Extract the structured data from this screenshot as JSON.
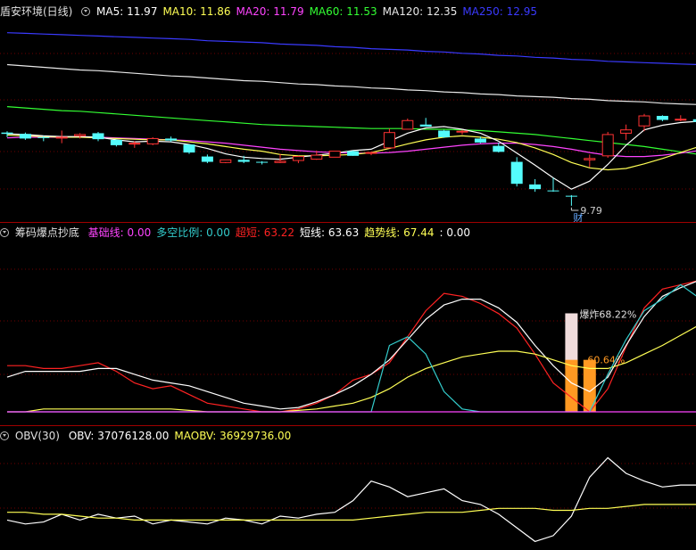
{
  "panels": {
    "price": {
      "title": "盾安环境(日线)",
      "indicators": [
        {
          "label": "MA5: ",
          "value": "11.97",
          "color": "#ffffff"
        },
        {
          "label": "MA10: ",
          "value": "11.86",
          "color": "#ffff55"
        },
        {
          "label": "MA20: ",
          "value": "11.79",
          "color": "#ff44ff"
        },
        {
          "label": "MA60: ",
          "value": "11.53",
          "color": "#33ff33"
        },
        {
          "label": "MA120: ",
          "value": "12.35",
          "color": "#e8e8e8"
        },
        {
          "label": "MA250: ",
          "value": "12.95",
          "color": "#3a3aff"
        }
      ],
      "low_label": "9.79",
      "note_label": "财"
    },
    "indicator": {
      "title": "筹码爆点抄底",
      "indicators": [
        {
          "label": "基础线: ",
          "value": "0.00",
          "color": "#ff44ff"
        },
        {
          "label": "多空比例: ",
          "value": "0.00",
          "color": "#33cccc"
        },
        {
          "label": "超短: ",
          "value": "63.22",
          "color": "#ff2222"
        },
        {
          "label": "短线: ",
          "value": "63.63",
          "color": "#ffffff"
        },
        {
          "label": "趋势线: ",
          "value": "67.44",
          "color": "#ffff55"
        },
        {
          "label": ": ",
          "value": "0.00",
          "color": "#ffffff"
        }
      ],
      "burst_label": "爆炸68.22%",
      "orange_label": "60.64%"
    },
    "obv": {
      "title": "OBV(30)",
      "indicators": [
        {
          "label": "OBV: ",
          "value": "37076128.00",
          "color": "#ffffff"
        },
        {
          "label": "MAOBV: ",
          "value": "36929736.00",
          "color": "#ffff55"
        }
      ]
    }
  },
  "colors": {
    "up": "#ff3333",
    "down": "#54fcfc",
    "divider": "#a00000",
    "ma5": "#ffffff",
    "ma10": "#ffff55",
    "ma20": "#ff44ff",
    "ma60": "#33ff33",
    "ma120": "#e8e8e8",
    "ma250": "#3a3aff",
    "burst": "#f0dcdc",
    "orange": "#ff9922"
  },
  "chart_data": [
    {
      "type": "candlestick",
      "candles": [
        {
          "o": 11.93,
          "h": 11.95,
          "l": 11.86,
          "c": 11.91
        },
        {
          "o": 11.91,
          "h": 11.93,
          "l": 11.82,
          "c": 11.84
        },
        {
          "o": 11.86,
          "h": 11.88,
          "l": 11.8,
          "c": 11.85
        },
        {
          "o": 11.86,
          "h": 11.96,
          "l": 11.77,
          "c": 11.86
        },
        {
          "o": 11.88,
          "h": 11.92,
          "l": 11.84,
          "c": 11.9
        },
        {
          "o": 11.92,
          "h": 11.94,
          "l": 11.8,
          "c": 11.83
        },
        {
          "o": 11.82,
          "h": 11.83,
          "l": 11.72,
          "c": 11.74
        },
        {
          "o": 11.77,
          "h": 11.8,
          "l": 11.7,
          "c": 11.77
        },
        {
          "o": 11.76,
          "h": 11.86,
          "l": 11.74,
          "c": 11.84
        },
        {
          "o": 11.84,
          "h": 11.87,
          "l": 11.79,
          "c": 11.81
        },
        {
          "o": 11.75,
          "h": 11.75,
          "l": 11.61,
          "c": 11.63
        },
        {
          "o": 11.57,
          "h": 11.6,
          "l": 11.47,
          "c": 11.49
        },
        {
          "o": 11.48,
          "h": 11.52,
          "l": 11.47,
          "c": 11.52
        },
        {
          "o": 11.52,
          "h": 11.58,
          "l": 11.47,
          "c": 11.49
        },
        {
          "o": 11.49,
          "h": 11.5,
          "l": 11.45,
          "c": 11.48
        },
        {
          "o": 11.48,
          "h": 11.61,
          "l": 11.47,
          "c": 11.5
        },
        {
          "o": 11.51,
          "h": 11.58,
          "l": 11.47,
          "c": 11.57
        },
        {
          "o": 11.53,
          "h": 11.66,
          "l": 11.52,
          "c": 11.59
        },
        {
          "o": 11.56,
          "h": 11.65,
          "l": 11.56,
          "c": 11.65
        },
        {
          "o": 11.65,
          "h": 11.66,
          "l": 11.58,
          "c": 11.58
        },
        {
          "o": 11.62,
          "h": 11.64,
          "l": 11.59,
          "c": 11.63
        },
        {
          "o": 11.7,
          "h": 11.99,
          "l": 11.7,
          "c": 11.93
        },
        {
          "o": 11.98,
          "h": 12.14,
          "l": 11.98,
          "c": 12.11
        },
        {
          "o": 12.05,
          "h": 12.15,
          "l": 12.02,
          "c": 12.02
        },
        {
          "o": 11.96,
          "h": 11.97,
          "l": 11.85,
          "c": 11.86
        },
        {
          "o": 11.95,
          "h": 11.97,
          "l": 11.9,
          "c": 11.95
        },
        {
          "o": 11.84,
          "h": 11.87,
          "l": 11.77,
          "c": 11.78
        },
        {
          "o": 11.73,
          "h": 11.78,
          "l": 11.63,
          "c": 11.64
        },
        {
          "o": 11.49,
          "h": 11.56,
          "l": 11.12,
          "c": 11.16
        },
        {
          "o": 11.15,
          "h": 11.23,
          "l": 11.04,
          "c": 11.08
        },
        {
          "o": 11.06,
          "h": 11.25,
          "l": 11.04,
          "c": 11.05
        },
        {
          "o": 10.98,
          "h": 10.99,
          "l": 10.83,
          "c": 10.97
        },
        {
          "o": 11.52,
          "h": 11.6,
          "l": 11.41,
          "c": 11.54
        },
        {
          "o": 11.58,
          "h": 11.94,
          "l": 11.55,
          "c": 11.9
        },
        {
          "o": 11.92,
          "h": 12.05,
          "l": 11.82,
          "c": 11.97
        },
        {
          "o": 12.03,
          "h": 12.21,
          "l": 11.95,
          "c": 12.18
        },
        {
          "o": 12.18,
          "h": 12.19,
          "l": 12.1,
          "c": 12.12
        },
        {
          "o": 12.13,
          "h": 12.19,
          "l": 12.1,
          "c": 12.13
        },
        {
          "o": 12.13,
          "h": 12.19,
          "l": 12.08,
          "c": 12.09
        }
      ],
      "ma": {
        "ma5": [
          11.91,
          11.9,
          11.88,
          11.87,
          11.87,
          11.86,
          11.82,
          11.79,
          11.8,
          11.79,
          11.75,
          11.69,
          11.61,
          11.56,
          11.54,
          11.53,
          11.56,
          11.59,
          11.62,
          11.66,
          11.68,
          11.8,
          11.92,
          12.0,
          12.02,
          11.98,
          11.92,
          11.8,
          11.62,
          11.44,
          11.25,
          11.08,
          11.2,
          11.45,
          11.74,
          11.97,
          12.04,
          12.08,
          12.1
        ],
        "ma10": [
          11.89,
          11.88,
          11.87,
          11.86,
          11.86,
          11.85,
          11.84,
          11.83,
          11.82,
          11.82,
          11.79,
          11.76,
          11.72,
          11.68,
          11.65,
          11.6,
          11.58,
          11.58,
          11.59,
          11.6,
          11.63,
          11.69,
          11.76,
          11.82,
          11.86,
          11.88,
          11.86,
          11.83,
          11.78,
          11.7,
          11.6,
          11.48,
          11.4,
          11.37,
          11.39,
          11.46,
          11.54,
          11.63,
          11.72
        ],
        "ma20": [
          11.85,
          11.86,
          11.86,
          11.86,
          11.86,
          11.86,
          11.85,
          11.84,
          11.83,
          11.82,
          11.81,
          11.79,
          11.77,
          11.74,
          11.71,
          11.68,
          11.66,
          11.64,
          11.63,
          11.62,
          11.62,
          11.63,
          11.65,
          11.68,
          11.71,
          11.74,
          11.76,
          11.77,
          11.77,
          11.75,
          11.72,
          11.68,
          11.63,
          11.59,
          11.57,
          11.57,
          11.59,
          11.62,
          11.66
        ],
        "ma60": [
          12.32,
          12.3,
          12.28,
          12.26,
          12.25,
          12.23,
          12.21,
          12.19,
          12.17,
          12.15,
          12.13,
          12.11,
          12.09,
          12.07,
          12.05,
          12.04,
          12.03,
          12.02,
          12.01,
          12.0,
          11.99,
          11.99,
          11.99,
          11.98,
          11.98,
          11.97,
          11.96,
          11.94,
          11.92,
          11.9,
          11.87,
          11.84,
          11.81,
          11.78,
          11.75,
          11.72,
          11.68,
          11.64,
          11.6
        ],
        "ma120": [
          12.95,
          12.93,
          12.91,
          12.89,
          12.87,
          12.86,
          12.84,
          12.82,
          12.8,
          12.78,
          12.77,
          12.75,
          12.73,
          12.71,
          12.7,
          12.68,
          12.66,
          12.65,
          12.63,
          12.62,
          12.6,
          12.59,
          12.57,
          12.56,
          12.54,
          12.53,
          12.51,
          12.5,
          12.48,
          12.47,
          12.46,
          12.44,
          12.43,
          12.41,
          12.4,
          12.39,
          12.37,
          12.36,
          12.35
        ],
        "ma250": [
          13.43,
          13.42,
          13.41,
          13.4,
          13.39,
          13.38,
          13.37,
          13.36,
          13.35,
          13.34,
          13.33,
          13.31,
          13.3,
          13.29,
          13.28,
          13.26,
          13.25,
          13.24,
          13.22,
          13.21,
          13.19,
          13.18,
          13.17,
          13.15,
          13.14,
          13.12,
          13.11,
          13.09,
          13.08,
          13.06,
          13.05,
          13.03,
          13.02,
          13.0,
          12.99,
          12.98,
          12.97,
          12.96,
          12.95
        ]
      },
      "ylim": [
        10.6,
        13.6
      ],
      "low_marker": {
        "index": 31,
        "value": 9.79
      }
    },
    {
      "type": "line",
      "series": [
        {
          "name": "超短",
          "color": "#ff2222",
          "values": [
            32,
            32,
            30,
            30,
            32,
            34,
            28,
            20,
            16,
            18,
            12,
            6,
            4,
            2,
            0,
            0,
            2,
            6,
            12,
            22,
            26,
            34,
            52,
            70,
            82,
            80,
            75,
            68,
            58,
            40,
            20,
            10,
            0,
            16,
            45,
            72,
            85,
            88,
            91
          ]
        },
        {
          "name": "短线",
          "color": "#ffffff",
          "values": [
            24,
            28,
            28,
            28,
            28,
            30,
            30,
            26,
            22,
            20,
            18,
            14,
            10,
            6,
            4,
            2,
            3,
            7,
            12,
            18,
            26,
            36,
            50,
            64,
            74,
            78,
            78,
            72,
            62,
            46,
            32,
            20,
            14,
            24,
            46,
            66,
            80,
            86,
            91
          ]
        },
        {
          "name": "趋势线",
          "color": "#ffff55",
          "values": [
            0,
            0,
            2,
            2,
            2,
            2,
            2,
            2,
            2,
            2,
            1,
            0,
            0,
            0,
            0,
            0,
            1,
            2,
            4,
            6,
            10,
            16,
            24,
            30,
            34,
            38,
            40,
            42,
            42,
            40,
            36,
            32,
            30,
            30,
            34,
            40,
            46,
            53,
            60
          ]
        },
        {
          "name": "多空比例",
          "color": "#33cccc",
          "values": [
            0,
            0,
            0,
            0,
            0,
            0,
            0,
            0,
            0,
            0,
            0,
            0,
            0,
            0,
            0,
            0,
            0,
            0,
            0,
            0,
            0,
            46,
            52,
            40,
            14,
            2,
            0,
            0,
            0,
            0,
            0,
            0,
            0,
            26,
            50,
            70,
            78,
            88,
            79
          ]
        },
        {
          "name": "基础线",
          "color": "#ff44ff",
          "values": [
            0,
            0,
            0,
            0,
            0,
            0,
            0,
            0,
            0,
            0,
            0,
            0,
            0,
            0,
            0,
            0,
            0,
            0,
            0,
            0,
            0,
            0,
            0,
            0,
            0,
            0,
            0,
            0,
            0,
            0,
            0,
            0,
            0,
            0,
            0,
            0,
            0,
            0,
            0
          ]
        }
      ],
      "bars": {
        "burst_index": 31,
        "burst_top": 68.22,
        "burst_base": 30,
        "orange": [
          {
            "index": 31,
            "value": 36
          },
          {
            "index": 32,
            "value": 36
          }
        ]
      },
      "ylim": [
        0,
        100
      ]
    },
    {
      "type": "line",
      "series": [
        {
          "name": "OBV",
          "color": "#ffffff",
          "values": [
            36.2,
            36.0,
            36.1,
            36.5,
            36.2,
            36.5,
            36.3,
            36.4,
            36.0,
            36.2,
            36.1,
            36.0,
            36.3,
            36.2,
            36.0,
            36.4,
            36.3,
            36.5,
            36.6,
            37.2,
            38.2,
            37.9,
            37.4,
            37.6,
            37.8,
            37.2,
            37.0,
            36.5,
            35.8,
            35.1,
            35.4,
            36.4,
            38.4,
            39.4,
            38.6,
            38.2,
            37.9,
            38.0,
            38.0
          ]
        },
        {
          "name": "MAOBV",
          "color": "#ffff55",
          "values": [
            36.6,
            36.6,
            36.5,
            36.5,
            36.4,
            36.3,
            36.3,
            36.2,
            36.2,
            36.2,
            36.2,
            36.2,
            36.2,
            36.2,
            36.2,
            36.2,
            36.2,
            36.2,
            36.2,
            36.2,
            36.3,
            36.4,
            36.5,
            36.6,
            36.6,
            36.6,
            36.7,
            36.8,
            36.8,
            36.8,
            36.7,
            36.7,
            36.8,
            36.8,
            36.9,
            37.0,
            37.0,
            37.0,
            37.0
          ]
        }
      ],
      "ylim": [
        34.8,
        40.2
      ]
    }
  ]
}
